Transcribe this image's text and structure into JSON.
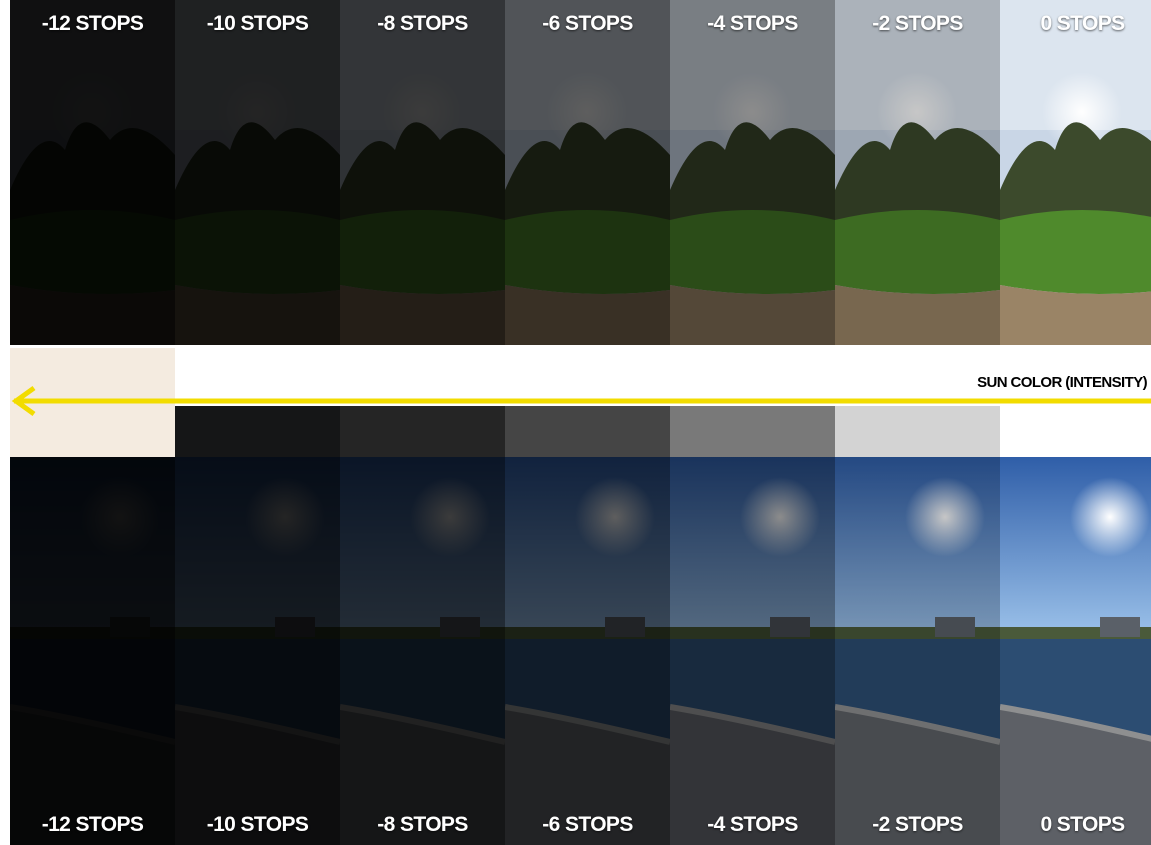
{
  "stops": [
    {
      "label": "-12 STOPS",
      "darkness": 0.93,
      "swatch": "#f4ebe0"
    },
    {
      "label": "-10 STOPS",
      "darkness": 0.86,
      "swatch": "#151617"
    },
    {
      "label": "-8 STOPS",
      "darkness": 0.77,
      "swatch": "#252525"
    },
    {
      "label": "-6 STOPS",
      "darkness": 0.63,
      "swatch": "#454545"
    },
    {
      "label": "-4 STOPS",
      "darkness": 0.45,
      "swatch": "#797979"
    },
    {
      "label": "-2 STOPS",
      "darkness": 0.22,
      "swatch": "#d3d3d3"
    },
    {
      "label": "0 STOPS",
      "darkness": 0.0,
      "swatch": "#ffffff"
    }
  ],
  "sun_color_label": "SUN COLOR (INTENSITY)",
  "colors": {
    "arrow": "#f2dc00",
    "label_text": "#ffffff",
    "sky_park": "#c9d6e6",
    "sky_harbor": "#3f74c4",
    "grass": "#4f8a2c",
    "path": "#9a8466",
    "water": "#2c4d72",
    "dock": "#5d6066"
  }
}
